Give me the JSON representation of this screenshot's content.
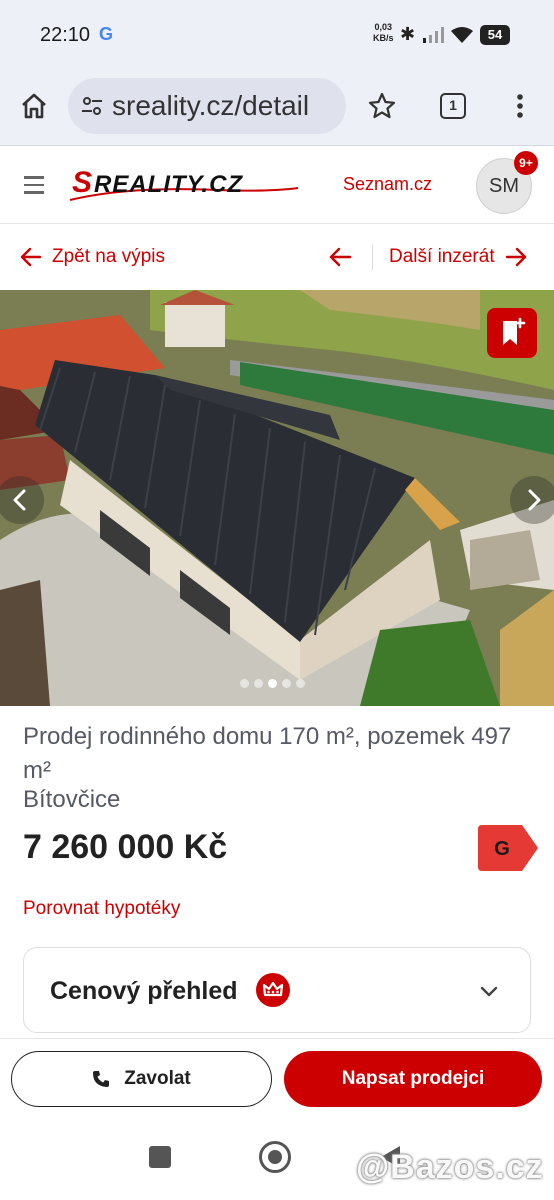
{
  "status_bar": {
    "time": "22:10",
    "google_glyph": "G",
    "net_speed_value": "0,03",
    "net_speed_unit": "KB/s",
    "battery": "54",
    "icons": [
      "bluetooth-icon",
      "signal-icon",
      "wifi-icon",
      "battery-icon"
    ]
  },
  "browser": {
    "url": "sreality.cz/detail",
    "tab_count": "1",
    "icons": [
      "home-icon",
      "site-settings-icon",
      "star-icon",
      "tabs-icon",
      "more-menu-icon"
    ]
  },
  "header": {
    "logo_text": "SREALITY.CZ",
    "seznam_link": "Seznam.cz",
    "avatar_initials": "SM",
    "notification_badge": "9+"
  },
  "nav": {
    "back_label": "Zpět na výpis",
    "next_label": "Další inzerát"
  },
  "gallery": {
    "total_images": 5,
    "active_index": 2
  },
  "listing": {
    "title": "Prodej rodinného domu 170 m², pozemek 497 m²",
    "location": "Bítovčice",
    "price": "7 260 000 Kč",
    "energy_class": "G",
    "mortgage_link": "Porovnat hypotéky"
  },
  "price_overview": {
    "title": "Cenový přehled"
  },
  "actions": {
    "call_label": "Zavolat",
    "write_label": "Napsat prodejci"
  },
  "watermark": "@Bazos.cz",
  "colors": {
    "brand_red": "#cc0000",
    "browser_chrome": "#eef0f7",
    "text_muted": "#555a66"
  }
}
